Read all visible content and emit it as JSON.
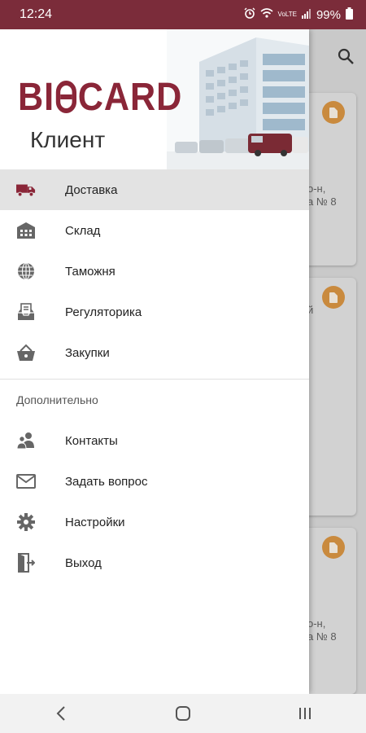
{
  "status": {
    "time": "12:24",
    "network": "VoLTE",
    "battery": "99%"
  },
  "drawer": {
    "logo_text_left": "BI",
    "logo_text_right": "CARD",
    "subtitle": "Клиент",
    "items": [
      {
        "label": "Доставка",
        "icon": "truck-icon",
        "active": true
      },
      {
        "label": "Склад",
        "icon": "warehouse-icon"
      },
      {
        "label": "Таможня",
        "icon": "globe-icon"
      },
      {
        "label": "Регуляторика",
        "icon": "inbox-document-icon"
      },
      {
        "label": "Закупки",
        "icon": "basket-icon"
      }
    ],
    "section_title": "Дополнительно",
    "extra_items": [
      {
        "label": "Контакты",
        "icon": "people-icon"
      },
      {
        "label": "Задать вопрос",
        "icon": "mail-icon"
      },
      {
        "label": "Настройки",
        "icon": "gear-icon"
      },
      {
        "label": "Выход",
        "icon": "exit-icon"
      }
    ]
  },
  "background": {
    "card1_text_a": "о-н,",
    "card1_text_b": "а № 8",
    "card2_text_a": "й",
    "card3_text_a": "о-н,",
    "card3_text_b": "а № 8"
  },
  "colors": {
    "brand": "#8a2638",
    "status_bar": "#7b2c3a",
    "doc_badge": "#c98a3e"
  }
}
